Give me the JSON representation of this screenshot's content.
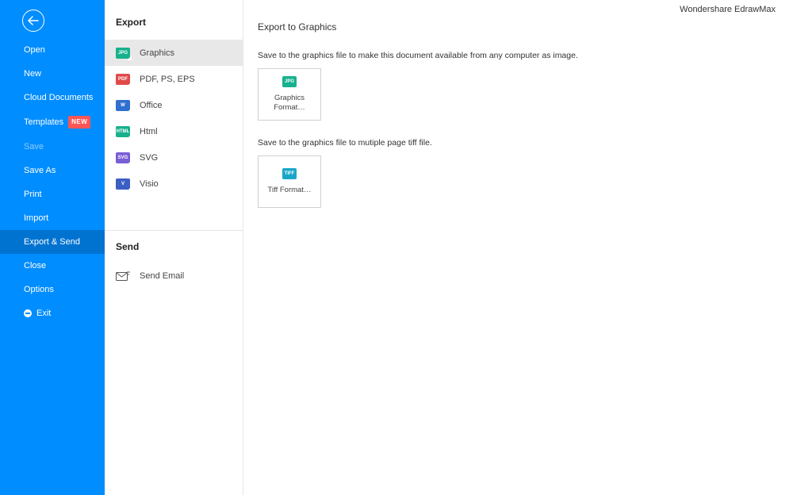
{
  "app_title": "Wondershare EdrawMax",
  "sidebar": {
    "items": [
      {
        "label": "Open"
      },
      {
        "label": "New"
      },
      {
        "label": "Cloud Documents"
      },
      {
        "label": "Templates",
        "badge": "NEW"
      },
      {
        "label": "Save",
        "faded": true
      },
      {
        "label": "Save As"
      },
      {
        "label": "Print"
      },
      {
        "label": "Import"
      },
      {
        "label": "Export & Send",
        "selected": true
      },
      {
        "label": "Close"
      },
      {
        "label": "Options"
      },
      {
        "label": "Exit",
        "icon": "exit"
      }
    ]
  },
  "midcol": {
    "section1_title": "Export",
    "export_items": [
      {
        "label": "Graphics",
        "icon": "JPG",
        "icon_class": "ic-jpg",
        "selected": true
      },
      {
        "label": "PDF, PS, EPS",
        "icon": "PDF",
        "icon_class": "ic-pdf"
      },
      {
        "label": "Office",
        "icon": "W",
        "icon_class": "ic-word"
      },
      {
        "label": "Html",
        "icon": "HTML",
        "icon_class": "ic-html"
      },
      {
        "label": "SVG",
        "icon": "SVG",
        "icon_class": "ic-svg"
      },
      {
        "label": "Visio",
        "icon": "V",
        "icon_class": "ic-visio"
      }
    ],
    "section2_title": "Send",
    "send_items": [
      {
        "label": "Send Email"
      }
    ]
  },
  "main": {
    "header": "Export to Graphics",
    "desc1": "Save to the graphics file to make this document available from any computer as image.",
    "option1_label": "Graphics Format…",
    "option1_icon": "JPG",
    "desc2": "Save to the graphics file to mutiple page tiff file.",
    "option2_label": "Tiff Format…",
    "option2_icon": "TIFF"
  }
}
